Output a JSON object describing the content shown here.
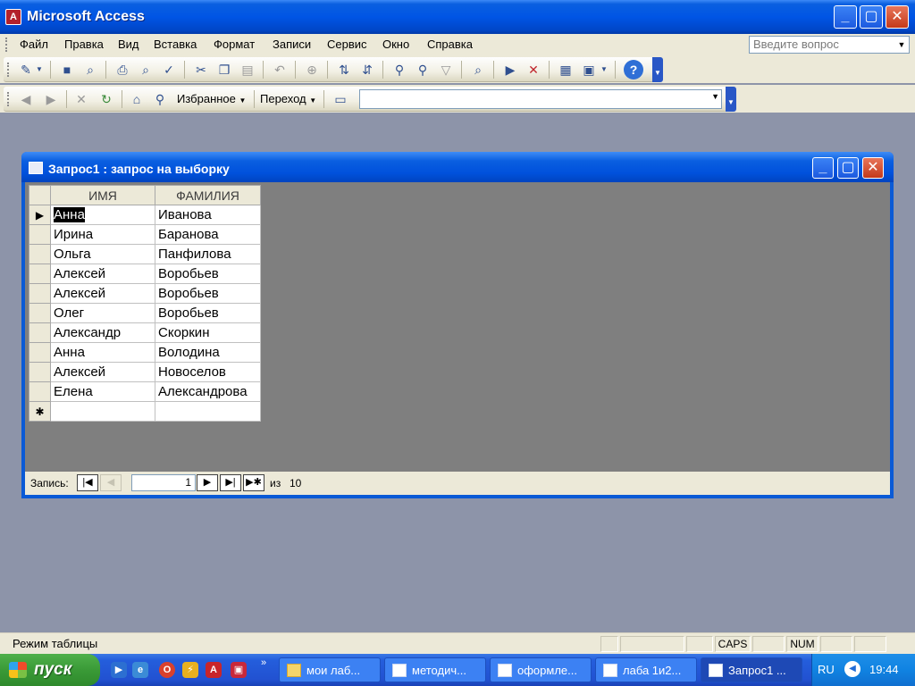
{
  "app": {
    "title": "Microsoft Access",
    "logo_glyph": "A"
  },
  "menu": {
    "items": [
      "Файл",
      "Правка",
      "Вид",
      "Вставка",
      "Формат",
      "Записи",
      "Сервис",
      "Окно",
      "Справка"
    ],
    "ask_placeholder": "Введите вопрос"
  },
  "web_toolbar": {
    "favorites_label": "Избранное",
    "go_label": "Переход"
  },
  "child_window": {
    "title": "Запрос1 : запрос на выборку",
    "columns": [
      "ИМЯ",
      "ФАМИЛИЯ"
    ],
    "rows": [
      [
        "Анна",
        "Иванова"
      ],
      [
        "Ирина",
        "Баранова"
      ],
      [
        "Ольга",
        "Панфилова"
      ],
      [
        "Алексей",
        "Воробьев"
      ],
      [
        "Алексей",
        "Воробьев"
      ],
      [
        "Олег",
        "Воробьев"
      ],
      [
        "Александр",
        "Скоркин"
      ],
      [
        "Анна",
        "Володина"
      ],
      [
        "Алексей",
        "Новоселов"
      ],
      [
        "Елена",
        "Александрова"
      ]
    ],
    "current_row_marker": "▶",
    "new_row_marker": "✱",
    "nav": {
      "label": "Запись:",
      "current": "1",
      "of_label": "из",
      "total": "10"
    }
  },
  "statusbar": {
    "text": "Режим таблицы",
    "caps": "CAPS",
    "num": "NUM"
  },
  "taskbar": {
    "start_label": "пуск",
    "tasks": [
      "мои лаб...",
      "методич...",
      "оформле...",
      "лаба 1и2...",
      "Запрос1 ..."
    ],
    "language": "RU",
    "clock": "19:44"
  }
}
